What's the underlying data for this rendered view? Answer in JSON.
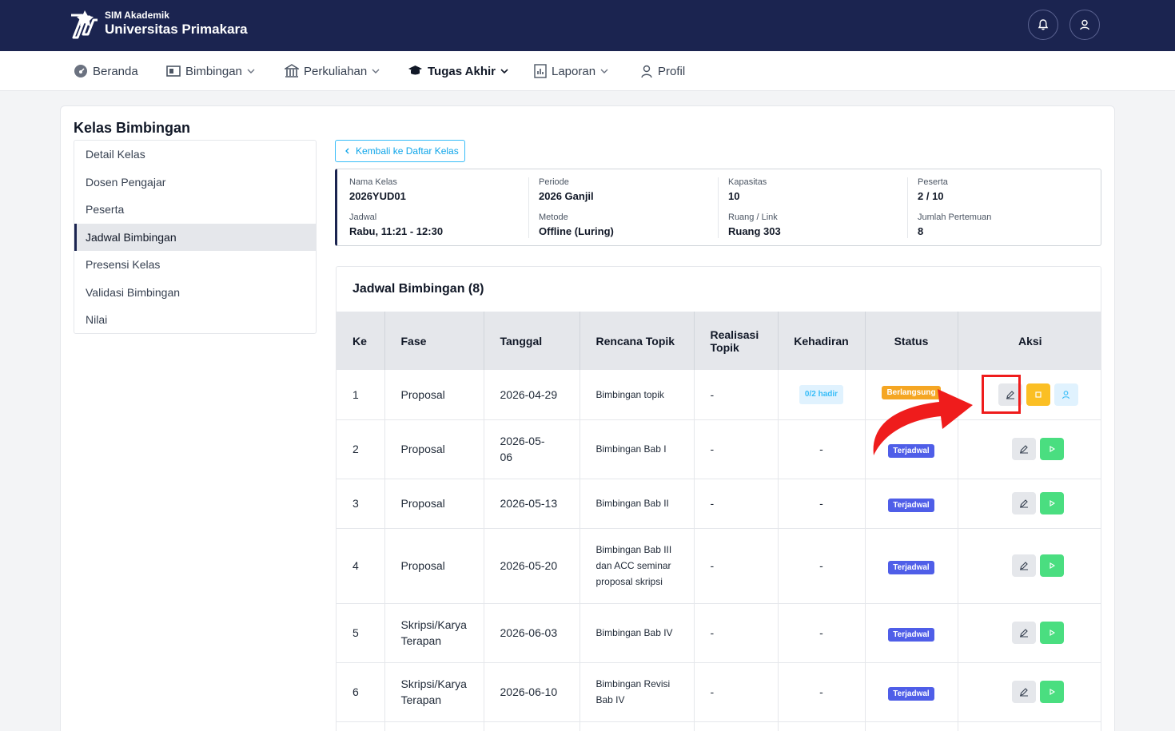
{
  "header": {
    "app_subtitle": "SIM Akademik",
    "app_title": "Universitas Primakara",
    "bell_icon": "bell-icon",
    "user_icon": "user-icon"
  },
  "nav": {
    "items": [
      {
        "label": "Beranda",
        "icon": "dashboard-icon"
      },
      {
        "label": "Bimbingan",
        "icon": "board-icon"
      },
      {
        "label": "Perkuliahan",
        "icon": "building-icon"
      },
      {
        "label": "Tugas Akhir",
        "icon": "graduation-cap-icon"
      },
      {
        "label": "Laporan",
        "icon": "report-icon"
      },
      {
        "label": "Profil",
        "icon": "user-icon"
      }
    ]
  },
  "page": {
    "title": "Kelas Bimbingan",
    "back_label": "Kembali ke Daftar Kelas"
  },
  "sidebar": {
    "items": [
      {
        "label": "Detail Kelas"
      },
      {
        "label": "Dosen Pengajar"
      },
      {
        "label": "Peserta"
      },
      {
        "label": "Jadwal Bimbingan",
        "active": true
      },
      {
        "label": "Presensi Kelas"
      },
      {
        "label": "Validasi Bimbingan"
      },
      {
        "label": "Nilai"
      }
    ]
  },
  "info": {
    "nama_kelas": {
      "label": "Nama Kelas",
      "value": "2026YUD01"
    },
    "periode": {
      "label": "Periode",
      "value": "2026 Ganjil"
    },
    "kapasitas": {
      "label": "Kapasitas",
      "value": "10"
    },
    "peserta": {
      "label": "Peserta",
      "value": "2 / 10"
    },
    "jadwal": {
      "label": "Jadwal",
      "value": "Rabu, 11:21 - 12:30"
    },
    "metode": {
      "label": "Metode",
      "value": "Offline (Luring)"
    },
    "ruang": {
      "label": "Ruang / Link",
      "value": "Ruang 303"
    },
    "jumlah": {
      "label": "Jumlah Pertemuan",
      "value": "8"
    }
  },
  "schedule": {
    "title": "Jadwal Bimbingan (8)",
    "columns": [
      "Ke",
      "Fase",
      "Tanggal",
      "Rencana Topik",
      "Realisasi Topik",
      "Kehadiran",
      "Status",
      "Aksi"
    ],
    "rows": [
      {
        "ke": "1",
        "fase": "Proposal",
        "tanggal": "2026-04-29",
        "topik": "Bimbingan topik",
        "realisasi": "-",
        "kehadiran": "0/2 hadir",
        "status": "Berlangsung",
        "status_color": "#f5a623"
      },
      {
        "ke": "2",
        "fase": "Proposal",
        "tanggal": "2026-05-06",
        "topik": "Bimbingan Bab I",
        "realisasi": "-",
        "kehadiran": "-",
        "status": "Terjadwal",
        "status_color": "#4f5ee8"
      },
      {
        "ke": "3",
        "fase": "Proposal",
        "tanggal": "2026-05-13",
        "topik": "Bimbingan Bab II",
        "realisasi": "-",
        "kehadiran": "-",
        "status": "Terjadwal",
        "status_color": "#4f5ee8"
      },
      {
        "ke": "4",
        "fase": "Proposal",
        "tanggal": "2026-05-20",
        "topik": "Bimbingan Bab III dan ACC seminar proposal skripsi",
        "realisasi": "-",
        "kehadiran": "-",
        "status": "Terjadwal",
        "status_color": "#4f5ee8"
      },
      {
        "ke": "5",
        "fase": "Skripsi/Karya Terapan",
        "tanggal": "2026-06-03",
        "topik": "Bimbingan Bab IV",
        "realisasi": "-",
        "kehadiran": "-",
        "status": "Terjadwal",
        "status_color": "#4f5ee8"
      },
      {
        "ke": "6",
        "fase": "Skripsi/Karya Terapan",
        "tanggal": "2026-06-10",
        "topik": "Bimbingan Revisi Bab IV",
        "realisasi": "-",
        "kehadiran": "-",
        "status": "Terjadwal",
        "status_color": "#4f5ee8"
      }
    ]
  },
  "annotation": {
    "highlight_color": "#ef1c1c",
    "arrow_icon": "curved-arrow-icon"
  }
}
